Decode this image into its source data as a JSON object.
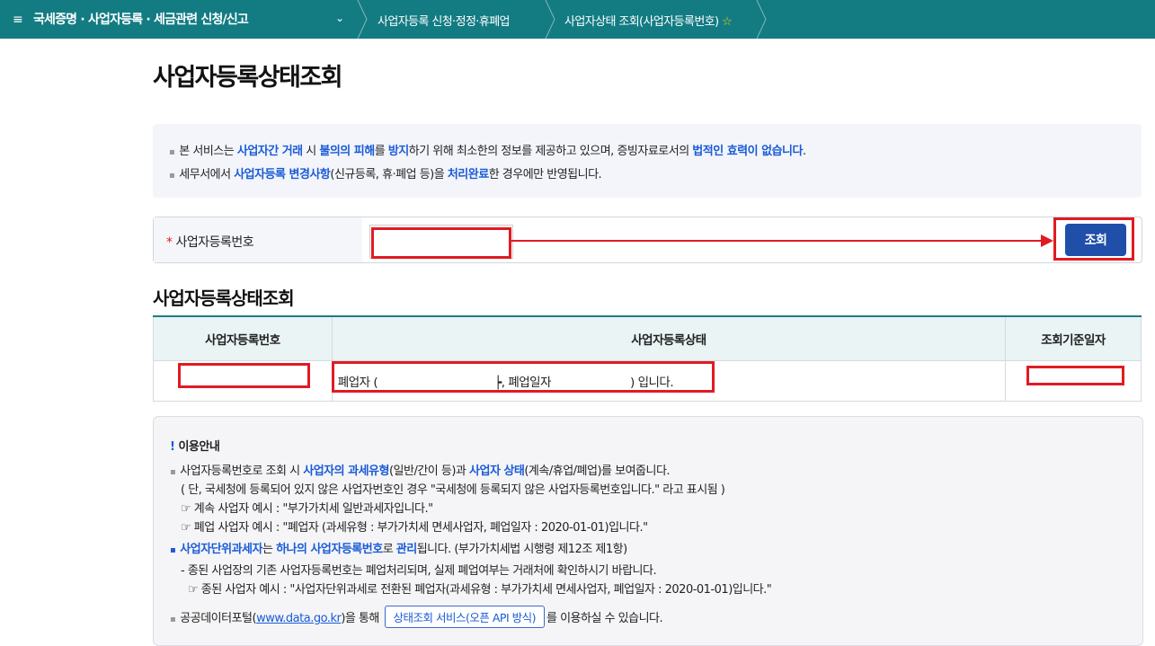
{
  "topbar": {
    "menu_icon": "≡",
    "menu_label": "국세증명 · 사업자등록 · 세금관련 신청/신고",
    "chevron": "⌄",
    "crumb1": "사업자등록 신청·정정·휴폐업",
    "crumb2": "사업자상태 조회(사업자등록번호)",
    "star_icon": "☆"
  },
  "page_title": "사업자등록상태조회",
  "notice": {
    "line1": [
      {
        "t": "본 서비스는 ",
        "h": false
      },
      {
        "t": "사업자간 거래",
        "h": true
      },
      {
        "t": " 시 ",
        "h": false
      },
      {
        "t": "불의의 피해",
        "h": true
      },
      {
        "t": "를 ",
        "h": false
      },
      {
        "t": "방지",
        "h": true
      },
      {
        "t": "하기 위해 최소한의 정보를 제공하고 있으며, 증빙자료로서의 ",
        "h": false
      },
      {
        "t": "법적인 효력이 없습니다",
        "h": true
      },
      {
        "t": ".",
        "h": false
      }
    ],
    "line2": [
      {
        "t": "세무서에서 ",
        "h": false
      },
      {
        "t": "사업자등록 변경사항",
        "h": true
      },
      {
        "t": "(신규등록, 휴·폐업 등)을 ",
        "h": false
      },
      {
        "t": "처리완료",
        "h": true
      },
      {
        "t": "한 경우에만 반영됩니다.",
        "h": false
      }
    ]
  },
  "search": {
    "required_mark": "*",
    "label": "사업자등록번호",
    "value": "",
    "button_label": "조회"
  },
  "result": {
    "title": "사업자등록상태조회",
    "headers": [
      "사업자등록번호",
      "사업자등록상태",
      "조회기준일자"
    ],
    "row": {
      "number": "",
      "status_prefix": "폐업자 (",
      "status_mid": "┝, 폐업일자",
      "status_suffix": ") 입니다.",
      "date": ""
    }
  },
  "guide": {
    "title": "이용안내",
    "bang": "!",
    "p1": [
      {
        "t": "사업자등록번호로 조회 시 ",
        "h": false
      },
      {
        "t": "사업자의 과세유형",
        "h": true
      },
      {
        "t": "(일반/간이 등)과 ",
        "h": false
      },
      {
        "t": "사업자 상태",
        "h": true
      },
      {
        "t": "(계속/휴업/폐업)를 보여줍니다.",
        "h": false
      }
    ],
    "p1_sub1": "( 단, 국세청에 등록되어 있지 않은 사업자번호인 경우 \"국세청에 등록되지 않은 사업자등록번호입니다.\" 라고 표시됨 )",
    "p1_sub2": "☞ 계속 사업자 예시 : \"부가가치세 일반과세자입니다.\"",
    "p1_sub3": "☞ 폐업 사업자 예시 : \"폐업자 (과세유형 : 부가가치세 면세사업자, 폐업일자 : 2020-01-01)입니다.\"",
    "p2": [
      {
        "t": "사업자단위과세자",
        "h": true
      },
      {
        "t": "는 ",
        "h": false
      },
      {
        "t": "하나의 사업자등록번호",
        "h": true
      },
      {
        "t": "로 ",
        "h": false
      },
      {
        "t": "관리",
        "h": true
      },
      {
        "t": "됩니다. (부가가치세법 시행령 제12조 제1항)",
        "h": false
      }
    ],
    "p2_sub1": "- 종된 사업장의 기존 사업자등록번호는 폐업처리되며, 실제 폐업여부는 거래처에 확인하시기 바랍니다.",
    "p2_sub2": "☞ 종된 사업자 예시 : \"사업자단위과세로 전환된 폐업자(과세유형 : 부가가치세 면세사업자, 폐업일자 : 2020-01-01)입니다.\"",
    "p3_pre": "공공데이터포털(",
    "p3_link": "www.data.go.kr",
    "p3_mid": ")을 통해",
    "p3_button": "상태조회 서비스(오픈 API 방식)",
    "p3_post": "를 이용하실 수 있습니다."
  }
}
